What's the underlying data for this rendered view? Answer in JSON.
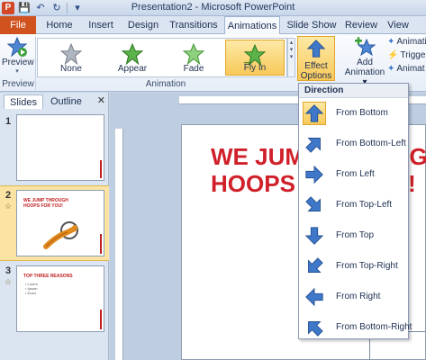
{
  "window": {
    "title": "Presentation2 - Microsoft PowerPoint",
    "app_icon": "P"
  },
  "tabs": [
    "File",
    "Home",
    "Insert",
    "Design",
    "Transitions",
    "Animations",
    "Slide Show",
    "Review",
    "View"
  ],
  "active_tab": "Animations",
  "ribbon": {
    "preview": {
      "label": "Preview",
      "group": "Preview"
    },
    "animation_group": "Animation",
    "gallery": [
      {
        "label": "None",
        "icon": "star-gray-icon"
      },
      {
        "label": "Appear",
        "icon": "star-green-icon"
      },
      {
        "label": "Fade",
        "icon": "star-green-icon"
      },
      {
        "label": "Fly In",
        "icon": "star-green-icon",
        "selected": true
      }
    ],
    "effect_options": {
      "line1": "Effect",
      "line2": "Options"
    },
    "add_animation": {
      "line1": "Add",
      "line2": "Animation"
    },
    "advanced": [
      "Animati",
      "Trigger",
      "Animat"
    ]
  },
  "left_pane": {
    "tabs": [
      "Slides",
      "Outline"
    ],
    "close": "✕",
    "slides": [
      {
        "number": "1",
        "title_line1": "",
        "title_line2": ""
      },
      {
        "number": "2",
        "title_line1": "WE JUMP THROUGH",
        "title_line2": "HOOPS FOR YOU!",
        "has_animation": true
      },
      {
        "number": "3",
        "title_line1": "TOP THREE REASONS",
        "title_line2": "",
        "bullets": [
          "• Lorem",
          "• Ipsum",
          "• Dolor"
        ],
        "has_animation": true
      }
    ]
  },
  "slide": {
    "title": "WE JUMP THROUGH\nHOOPS FOR YOU!"
  },
  "dropdown": {
    "header": "Direction",
    "items": [
      {
        "label": "From Bottom",
        "arrow": "up",
        "selected": true
      },
      {
        "label": "From Bottom-Left",
        "arrow": "up-right"
      },
      {
        "label": "From Left",
        "arrow": "right"
      },
      {
        "label": "From Top-Left",
        "arrow": "down-right"
      },
      {
        "label": "From Top",
        "arrow": "down"
      },
      {
        "label": "From Top-Right",
        "arrow": "down-left"
      },
      {
        "label": "From Right",
        "arrow": "left"
      },
      {
        "label": "From Bottom-Right",
        "arrow": "up-left"
      }
    ]
  },
  "colors": {
    "file_tab": "#d0521e",
    "accent_title": "#d0202a",
    "arrow_blue": "#3f78c8",
    "selection": "#f8c95a"
  }
}
